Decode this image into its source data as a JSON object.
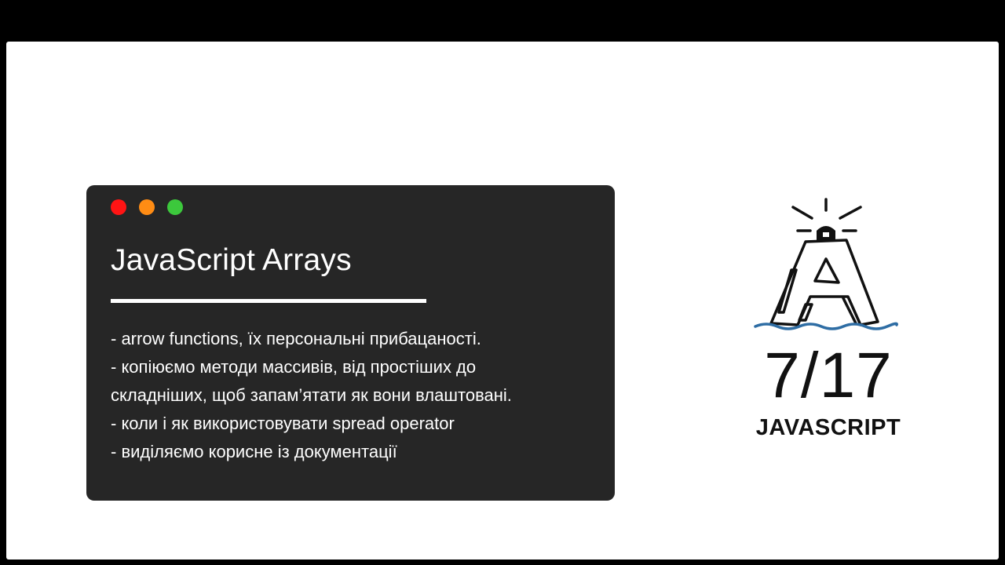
{
  "card": {
    "title": "JavaScript Arrays",
    "window_dots": [
      {
        "name": "red",
        "color": "#ff1414"
      },
      {
        "name": "yellow",
        "color": "#ff8c14"
      },
      {
        "name": "green",
        "color": "#3cc83c"
      }
    ],
    "bullets": [
      "- arrow functions, їх персональні прибацаності.",
      "- копіюємо методи массивів, від простіших до",
      "складніших, щоб запам’ятати як вони влаштовані.",
      "- коли і як використовувати spread operator",
      "- виділяємо корисне із документації"
    ]
  },
  "badge": {
    "logo_icon": "lighthouse-a-logo-icon",
    "counter": "7/17",
    "course_name": "JAVASCRIPT"
  },
  "colors": {
    "frame": "#000000",
    "background": "#ffffff",
    "card": "#262626",
    "water": "#2e6da4"
  }
}
